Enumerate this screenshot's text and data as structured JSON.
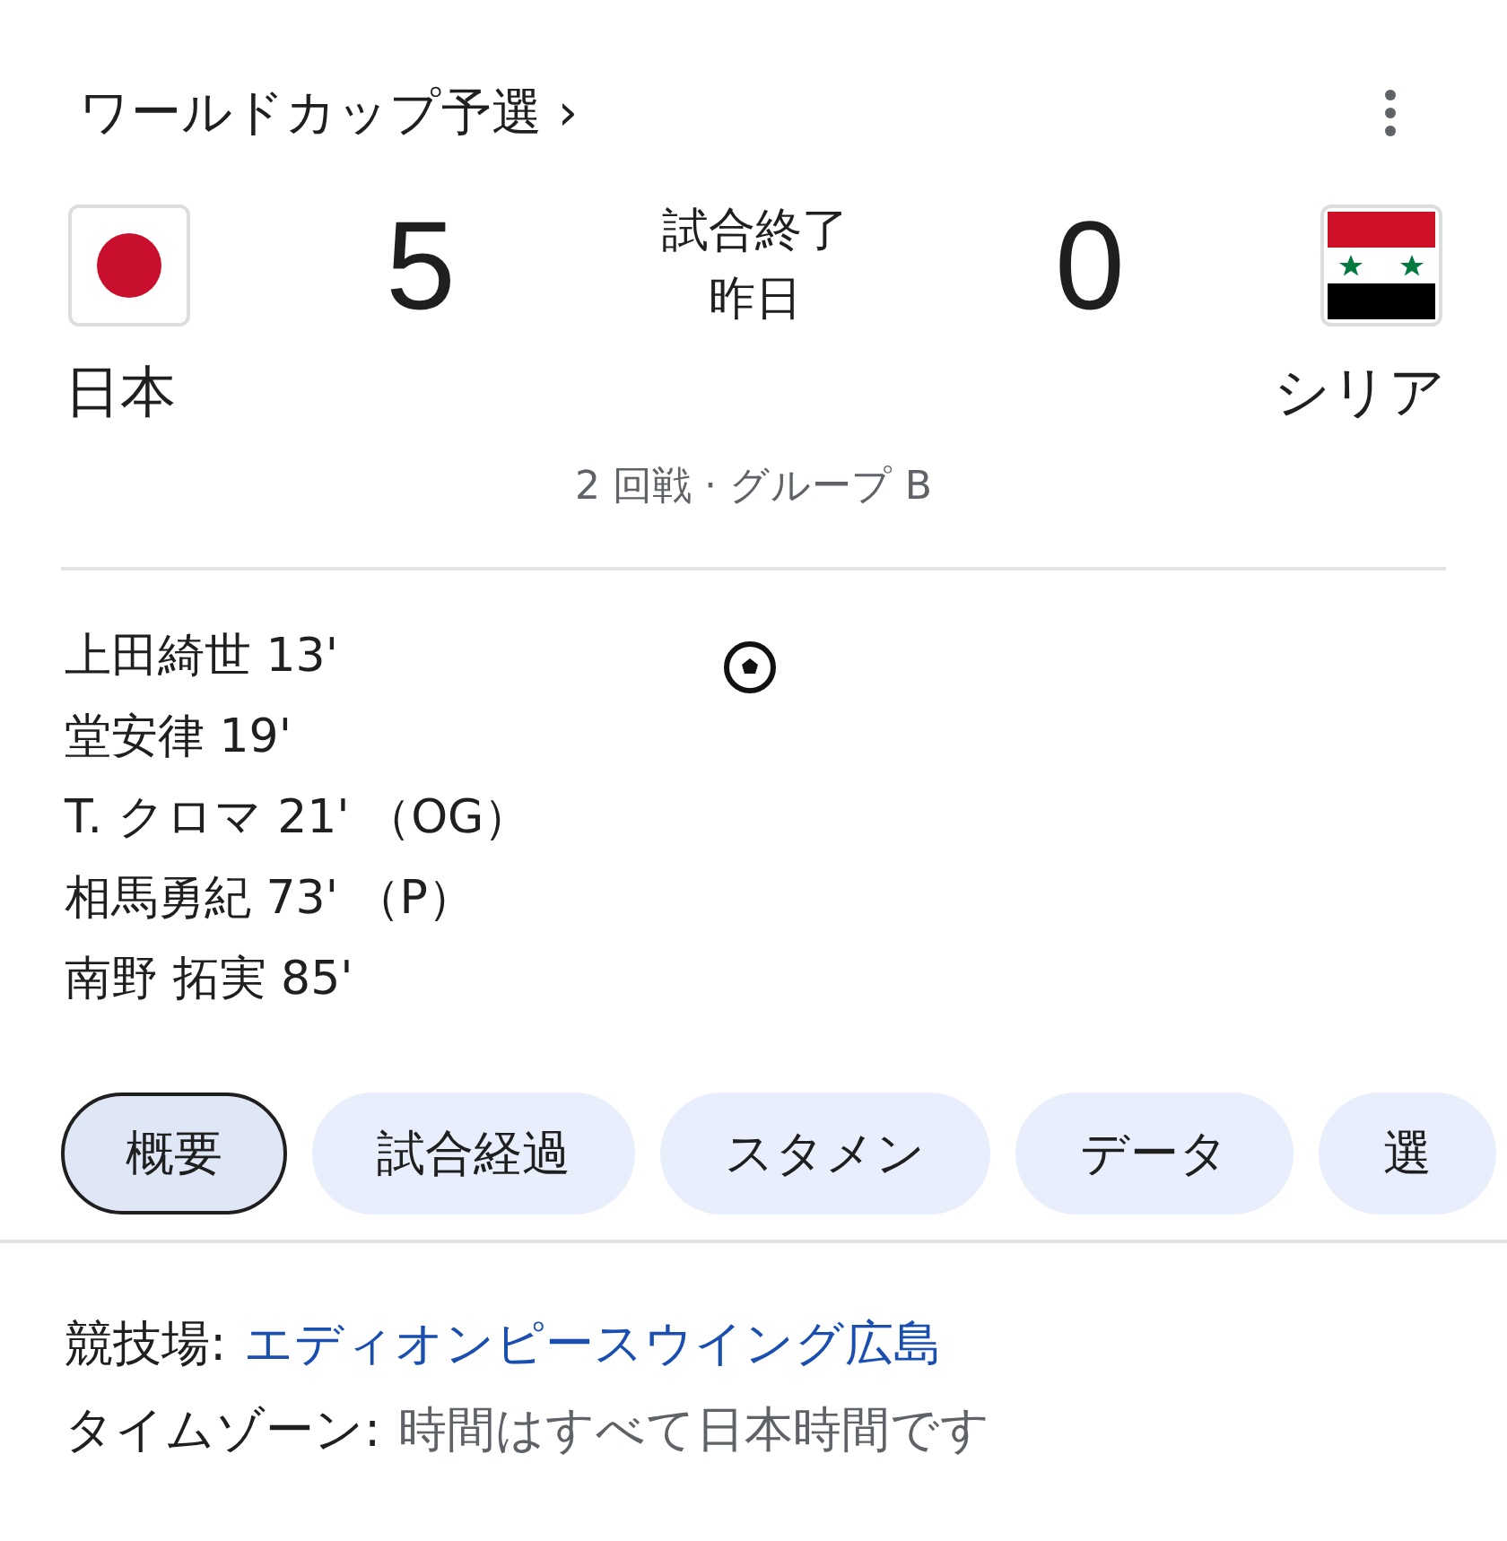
{
  "header": {
    "title": "ワールドカップ予選 ›"
  },
  "match": {
    "home": {
      "name": "日本",
      "score": "5",
      "kind": "disc"
    },
    "away": {
      "name": "シリア",
      "score": "0",
      "kind": "stars"
    },
    "status": "試合終了",
    "date": "昨日",
    "round": "2 回戦 · グループ B"
  },
  "scorers": [
    "上田綺世 13'",
    "堂安律 19'",
    "T. クロマ 21' （OG）",
    "相馬勇紀 73' （P）",
    "南野 拓実 85'"
  ],
  "tabs": [
    {
      "label": "概要",
      "selected": true
    },
    {
      "label": "試合経過",
      "selected": false
    },
    {
      "label": "スタメン",
      "selected": false
    },
    {
      "label": "データ",
      "selected": false
    },
    {
      "label": "選",
      "selected": false
    }
  ],
  "info": [
    {
      "label": "競技場:",
      "value": "エディオンピースウイング広島",
      "kind": "link"
    },
    {
      "label": "タイムゾーン:",
      "value": "時間はすべて日本時間です",
      "kind": "text"
    }
  ]
}
